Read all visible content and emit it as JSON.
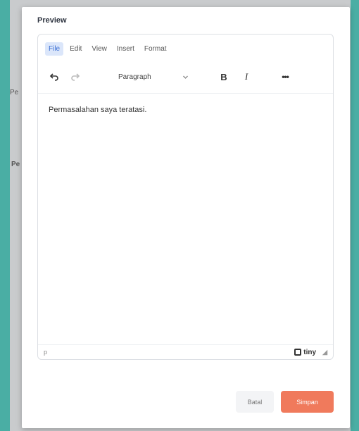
{
  "background": {
    "fragments": [
      "Pe",
      "Pe"
    ]
  },
  "modal": {
    "label": "Preview",
    "editor": {
      "menu": [
        "File",
        "Edit",
        "View",
        "Insert",
        "Format"
      ],
      "format_select": "Paragraph",
      "bold": "B",
      "italic": "I",
      "more": "•••",
      "content": "Permasalahan saya teratasi.",
      "status_path": "p",
      "brand": "tiny"
    },
    "buttons": {
      "cancel": "Batal",
      "save": "Simpan"
    }
  },
  "colors": {
    "accent": "#f07a5c",
    "menu_active": "#dbe6fa",
    "backdrop": "#4aaea4"
  }
}
